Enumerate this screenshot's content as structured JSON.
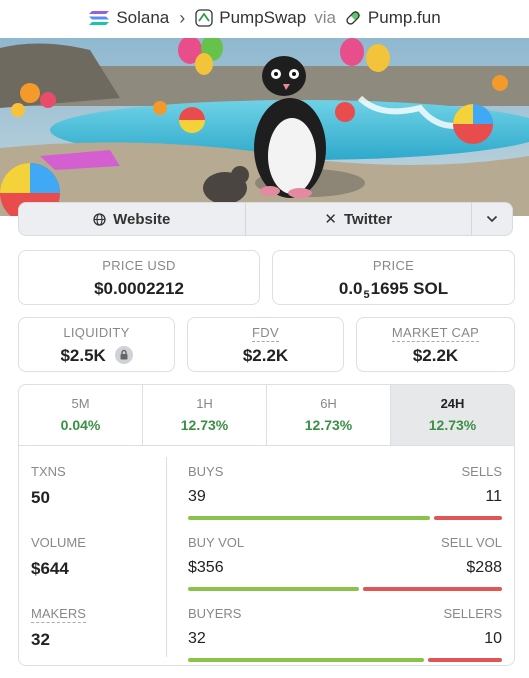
{
  "breadcrumb": {
    "chain": "Solana",
    "dex": "PumpSwap",
    "via": "via",
    "launchpad": "Pump.fun"
  },
  "links": {
    "website": "Website",
    "twitter": "Twitter"
  },
  "price": {
    "usd_label": "PRICE USD",
    "usd_value": "$0.0002212",
    "native_label": "PRICE",
    "native_prefix": "0.0",
    "native_sub": "5",
    "native_rest": "1695 SOL"
  },
  "metrics": {
    "liquidity_label": "LIQUIDITY",
    "liquidity_value": "$2.5K",
    "fdv_label": "FDV",
    "fdv_value": "$2.2K",
    "mcap_label": "MARKET CAP",
    "mcap_value": "$2.2K"
  },
  "tabs": [
    {
      "label": "5M",
      "value": "0.04%"
    },
    {
      "label": "1H",
      "value": "12.73%"
    },
    {
      "label": "6H",
      "value": "12.73%"
    },
    {
      "label": "24H",
      "value": "12.73%"
    }
  ],
  "stats": {
    "txns": {
      "label": "TXNS",
      "value": "50",
      "left_label": "BUYS",
      "left_value": "39",
      "right_label": "SELLS",
      "right_value": "11",
      "left_share": 0.78
    },
    "volume": {
      "label": "VOLUME",
      "value": "$644",
      "left_label": "BUY VOL",
      "left_value": "$356",
      "right_label": "SELL VOL",
      "right_value": "$288",
      "left_share": 0.55
    },
    "makers": {
      "label": "MAKERS",
      "value": "32",
      "left_label": "BUYERS",
      "left_value": "32",
      "right_label": "SELLERS",
      "right_value": "10",
      "left_share": 0.76
    }
  },
  "colors": {
    "positive": "#3b8f45",
    "buy_bar": "#8bc34a",
    "sell_bar": "#e05656"
  }
}
